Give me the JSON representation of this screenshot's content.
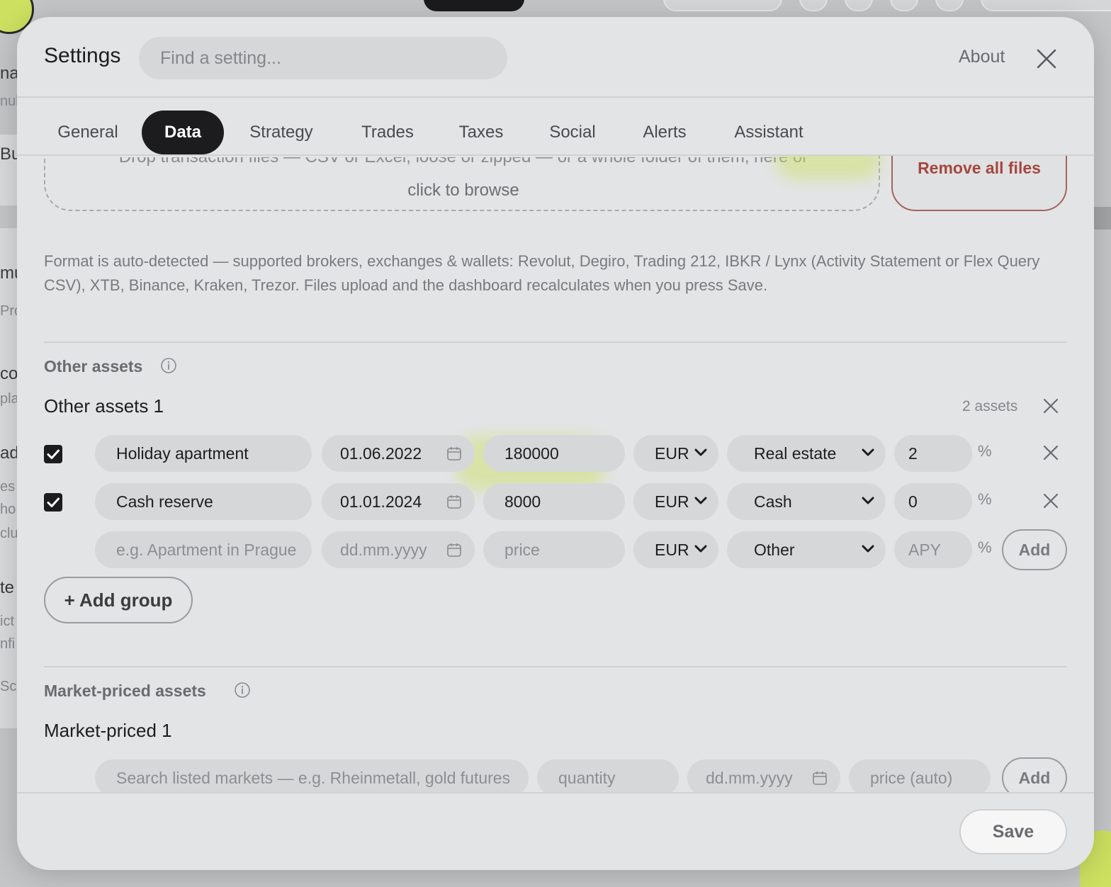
{
  "backdrop": {
    "left_texts": [
      "na",
      "nul",
      "Bu",
      "mu",
      "Pro",
      "co",
      "pla",
      "ad",
      "es",
      "ho",
      "clu",
      "te",
      "ict",
      "nfi",
      "Sc"
    ]
  },
  "header": {
    "title": "Settings",
    "search_placeholder": "Find a setting...",
    "about_label": "About"
  },
  "tabs": [
    {
      "label": "General",
      "active": false
    },
    {
      "label": "Data",
      "active": true
    },
    {
      "label": "Strategy",
      "active": false
    },
    {
      "label": "Trades",
      "active": false
    },
    {
      "label": "Taxes",
      "active": false
    },
    {
      "label": "Social",
      "active": false
    },
    {
      "label": "Alerts",
      "active": false
    },
    {
      "label": "Assistant",
      "active": false
    }
  ],
  "upload": {
    "hint_cut": "Drop transaction files — CSV or Excel, loose or zipped — or a whole folder of them, here or",
    "hint_browse": "click to browse",
    "remove_all_label": "Remove all files",
    "format_note": "Format is auto-detected — supported brokers, exchanges & wallets: Revolut, Degiro, Trading 212, IBKR / Lynx (Activity Statement or Flex Query CSV), XTB, Binance, Kraken, Trezor. Files upload and the dashboard recalculates when you press Save."
  },
  "other_assets": {
    "section_title": "Other assets",
    "group_title": "Other assets 1",
    "count_label": "2 assets",
    "rows": [
      {
        "checked": true,
        "name": "Holiday apartment",
        "date": "01.06.2022",
        "price": "180000",
        "currency": "EUR",
        "type": "Real estate",
        "apy": "2"
      },
      {
        "checked": true,
        "name": "Cash reserve",
        "date": "01.01.2024",
        "price": "8000",
        "currency": "EUR",
        "type": "Cash",
        "apy": "0"
      }
    ],
    "new_row": {
      "name_placeholder": "e.g. Apartment in Prague",
      "date_placeholder": "dd.mm.yyyy",
      "price_placeholder": "price",
      "currency": "EUR",
      "type": "Other",
      "apy_placeholder": "APY",
      "add_label": "Add"
    },
    "percent_sign": "%",
    "add_group_label": "+ Add group"
  },
  "market_assets": {
    "section_title": "Market-priced assets",
    "group_title": "Market-priced 1",
    "search_placeholder": "Search listed markets — e.g. Rheinmetall, gold futures",
    "quantity_placeholder": "quantity",
    "date_placeholder": "dd.mm.yyyy",
    "price_placeholder": "price (auto)",
    "add_label": "Add"
  },
  "footer": {
    "save_label": "Save"
  }
}
